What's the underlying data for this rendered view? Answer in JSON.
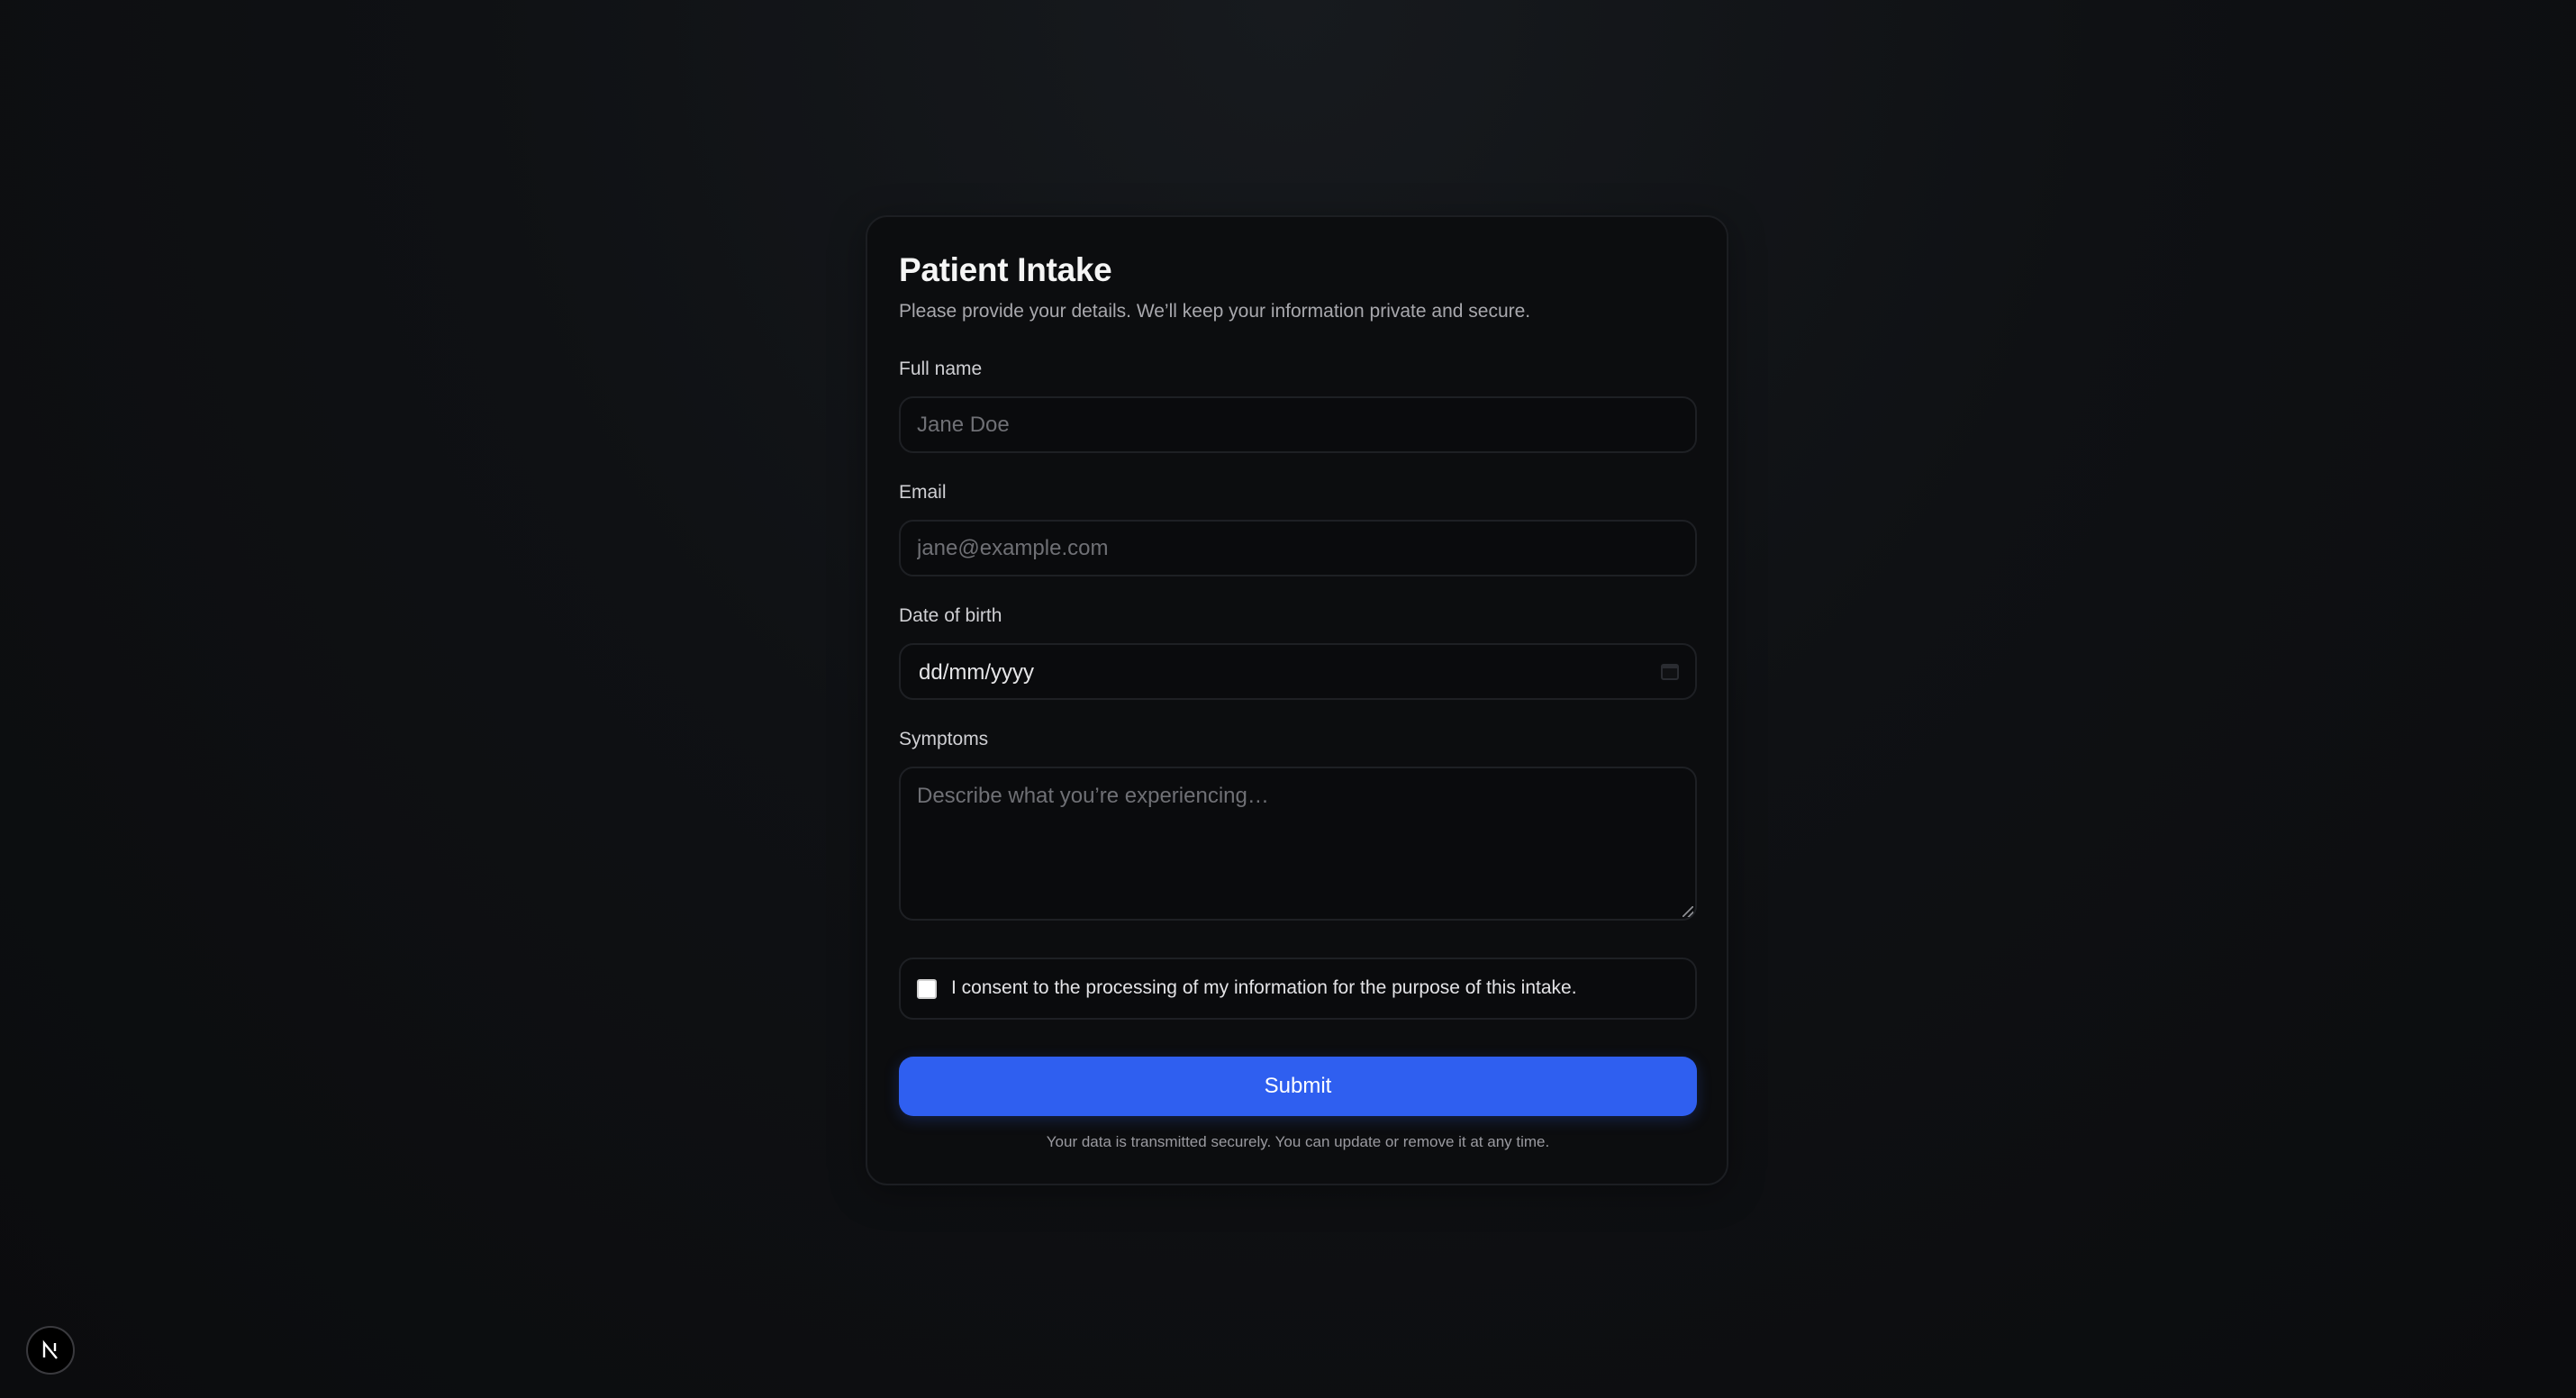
{
  "form": {
    "title": "Patient Intake",
    "subtitle": "Please provide your details. We’ll keep your information private and secure.",
    "fields": {
      "full_name": {
        "label": "Full name",
        "value": "",
        "placeholder": "Jane Doe"
      },
      "email": {
        "label": "Email",
        "value": "",
        "placeholder": "jane@example.com"
      },
      "dob": {
        "label": "Date of birth",
        "display": "dd/mm/yyyy",
        "icon": "calendar-icon"
      },
      "symptoms": {
        "label": "Symptoms",
        "value": "",
        "placeholder": "Describe what you’re experiencing…"
      }
    },
    "consent": {
      "checked": false,
      "label": "I consent to the processing of my information for the purpose of this intake."
    },
    "submit_label": "Submit",
    "footnote": "Your data is transmitted securely. You can update or remove it at any time."
  },
  "dev_indicator": {
    "glyph": "N",
    "icon": "nextjs-logo-icon"
  },
  "colors": {
    "background": "#0f1114",
    "card": "#0c0d0f",
    "accent": "#2f5ff0",
    "text": "#ededed",
    "muted": "#a8a8ad"
  }
}
